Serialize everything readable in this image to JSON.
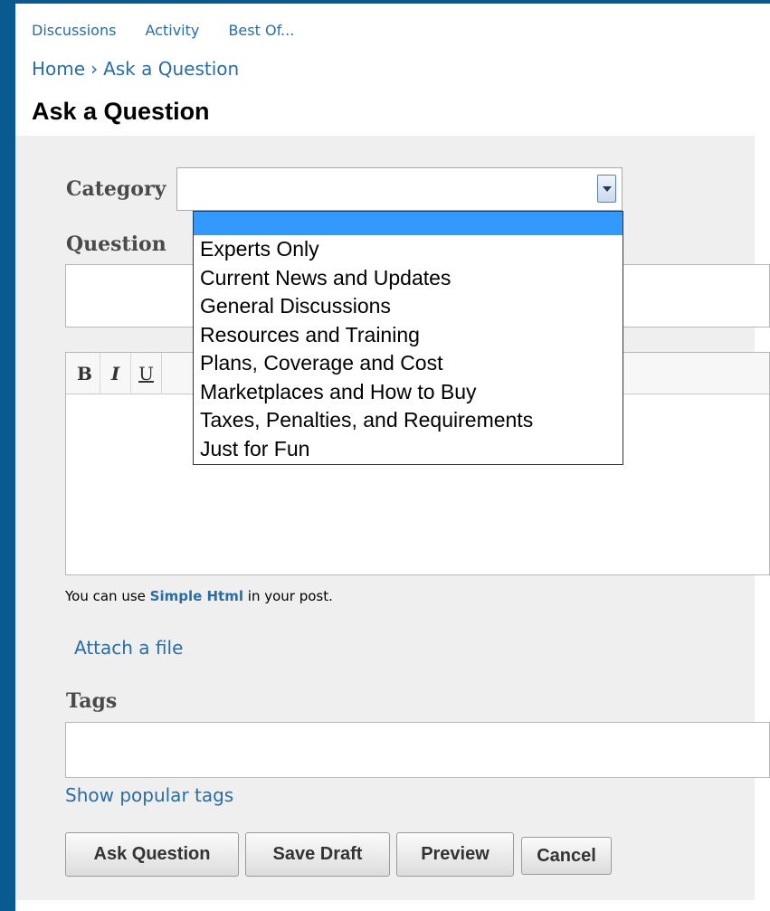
{
  "topnav": [
    "Discussions",
    "Activity",
    "Best Of..."
  ],
  "breadcrumb": {
    "home": "Home",
    "separator": "›",
    "current": "Ask a Question"
  },
  "title": "Ask a Question",
  "form": {
    "category_label": "Category",
    "category_value": "",
    "question_label": "Question",
    "question_value": "",
    "toolbar": {
      "bold": "B",
      "italic": "I",
      "underline": "U"
    },
    "body_value": "",
    "hint_prefix": "You can use ",
    "hint_link": "Simple Html",
    "hint_suffix": " in your post.",
    "attach_link": "Attach a file",
    "tags_label": "Tags",
    "tags_value": "",
    "popular_tags_link": "Show popular tags"
  },
  "dropdown": {
    "highlighted": "",
    "options": [
      "Experts Only",
      "Current News and Updates",
      "General Discussions",
      "Resources and Training",
      "Plans, Coverage and Cost",
      "Marketplaces and How to Buy",
      "Taxes, Penalties, and Requirements",
      "Just for Fun"
    ]
  },
  "buttons": {
    "ask": "Ask Question",
    "save_draft": "Save Draft",
    "preview": "Preview",
    "cancel": "Cancel"
  },
  "colors": {
    "frame_bg": "#0a5a92",
    "link": "#2a6da3",
    "panel_bg": "#efefef",
    "dropdown_highlight": "#3399ff"
  },
  "icons": {
    "select_arrow": "chevron-down-icon"
  }
}
